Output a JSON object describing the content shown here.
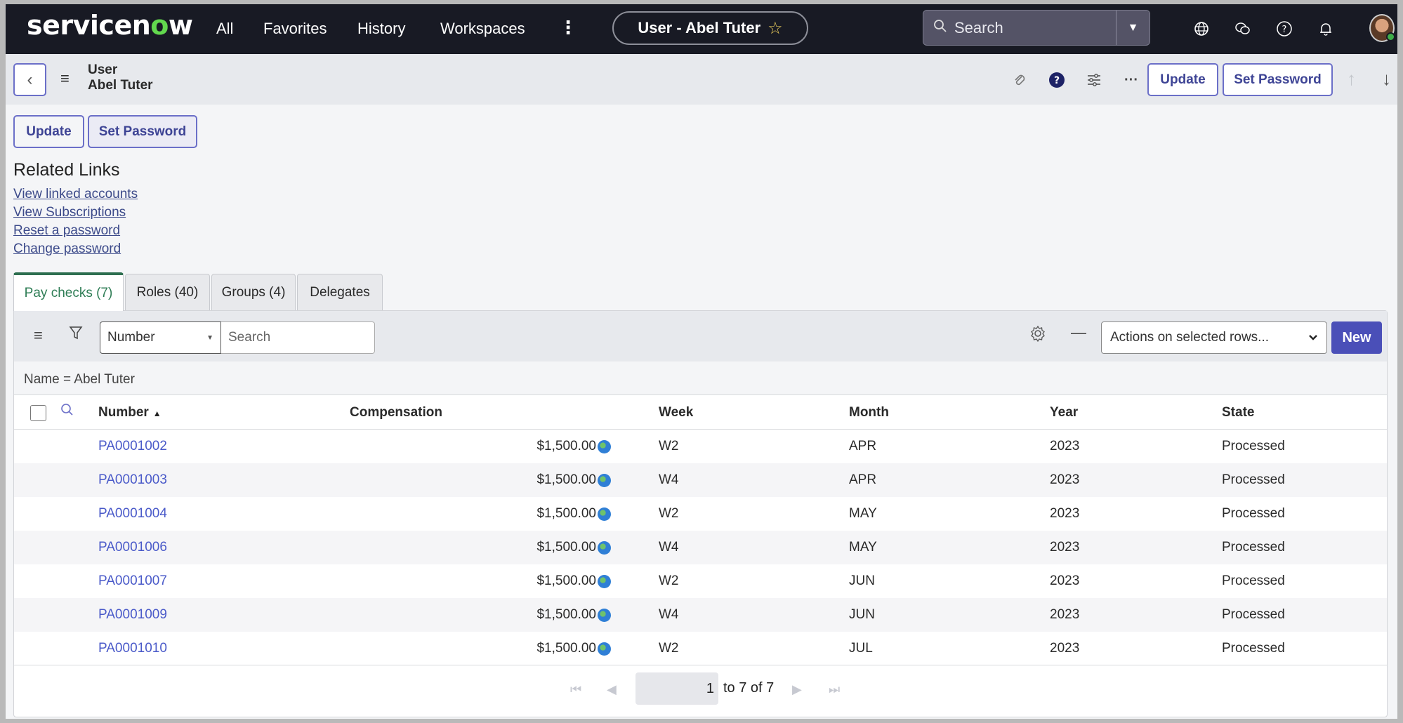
{
  "nav": {
    "logo_prefix": "servicen",
    "logo_o": "o",
    "logo_suffix": "w",
    "links": [
      "All",
      "Favorites",
      "History",
      "Workspaces"
    ],
    "more_icon": "kebab-vertical-icon",
    "record_title": "User - Abel Tuter",
    "star_icon": "☆",
    "search_placeholder": "Search",
    "search_dropdown_icon": "▼",
    "icons": [
      "globe-icon",
      "chat-icon",
      "help-icon",
      "bell-icon"
    ]
  },
  "record_header": {
    "back_icon": "‹",
    "menu_icon": "≡",
    "table_name": "User",
    "record_name": "Abel Tuter",
    "icons": [
      "paperclip-icon",
      "help-filled-icon",
      "sliders-icon",
      "more-horizontal-icon"
    ],
    "update_label": "Update",
    "set_password_label": "Set Password",
    "up_icon": "↑",
    "down_icon": "↓"
  },
  "form_buttons": {
    "update_label": "Update",
    "set_password_label": "Set Password"
  },
  "related_links": {
    "title": "Related Links",
    "links": [
      "View linked accounts",
      "View Subscriptions",
      "Reset a password",
      "Change password"
    ]
  },
  "tabs": [
    {
      "label": "Pay checks (7)",
      "active": true
    },
    {
      "label": "Roles (40)",
      "active": false
    },
    {
      "label": "Groups (4)",
      "active": false
    },
    {
      "label": "Delegates",
      "active": false
    }
  ],
  "list": {
    "field_select": "Number",
    "search_placeholder": "Search",
    "actions_placeholder": "Actions on selected rows...",
    "new_label": "New",
    "filter_text": "Name = Abel Tuter",
    "columns": [
      "Number",
      "Compensation",
      "Week",
      "Month",
      "Year",
      "State"
    ],
    "sort_indicator": "▲",
    "rows": [
      {
        "number": "PA0001002",
        "compensation": "$1,500.00",
        "week": "W2",
        "month": "APR",
        "year": "2023",
        "state": "Processed"
      },
      {
        "number": "PA0001003",
        "compensation": "$1,500.00",
        "week": "W4",
        "month": "APR",
        "year": "2023",
        "state": "Processed"
      },
      {
        "number": "PA0001004",
        "compensation": "$1,500.00",
        "week": "W2",
        "month": "MAY",
        "year": "2023",
        "state": "Processed"
      },
      {
        "number": "PA0001006",
        "compensation": "$1,500.00",
        "week": "W4",
        "month": "MAY",
        "year": "2023",
        "state": "Processed"
      },
      {
        "number": "PA0001007",
        "compensation": "$1,500.00",
        "week": "W2",
        "month": "JUN",
        "year": "2023",
        "state": "Processed"
      },
      {
        "number": "PA0001009",
        "compensation": "$1,500.00",
        "week": "W4",
        "month": "JUN",
        "year": "2023",
        "state": "Processed"
      },
      {
        "number": "PA0001010",
        "compensation": "$1,500.00",
        "week": "W2",
        "month": "JUL",
        "year": "2023",
        "state": "Processed"
      }
    ],
    "pager": {
      "first_icon": "⏮",
      "prev_icon": "◀",
      "current_page": "1",
      "range_text": "to 7 of 7",
      "next_icon": "▶",
      "last_icon": "⏭"
    }
  },
  "colors": {
    "nav_bg": "#181a24",
    "accent": "#4a4fb8",
    "link": "#4a5ac9",
    "active_tab": "#2d6e4f",
    "logo_green": "#62d84e"
  }
}
